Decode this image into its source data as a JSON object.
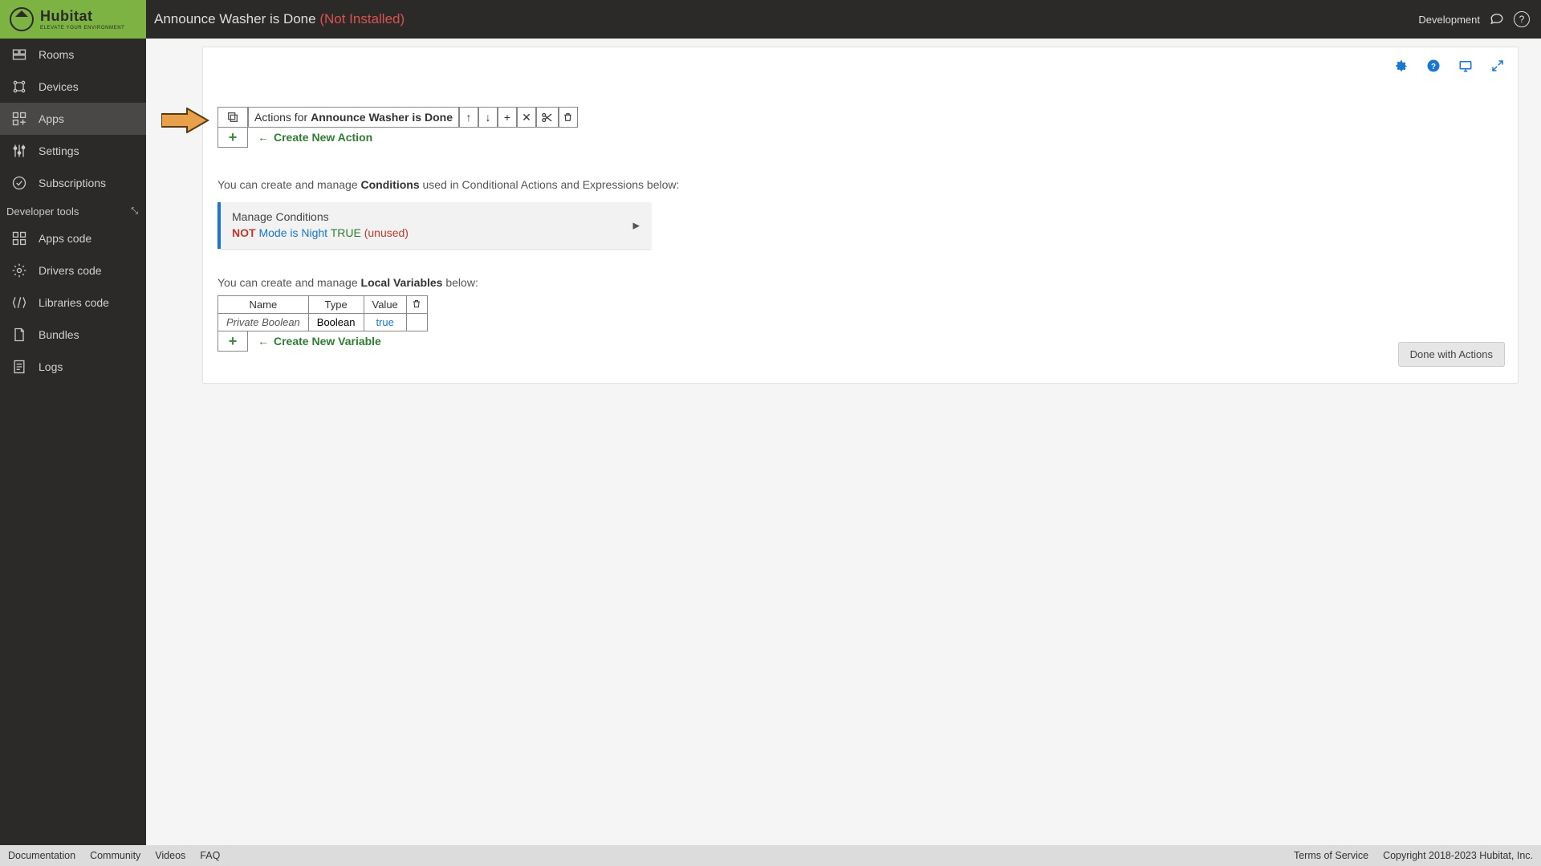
{
  "header": {
    "page_title": "Announce Washer is Done",
    "status_suffix": "(Not Installed)",
    "right_label": "Development",
    "brand": "Hubitat",
    "brand_sub": "ELEVATE YOUR ENVIRONMENT"
  },
  "sidebar": {
    "items": [
      {
        "label": "Rooms"
      },
      {
        "label": "Devices"
      },
      {
        "label": "Apps"
      },
      {
        "label": "Settings"
      },
      {
        "label": "Subscriptions"
      }
    ],
    "dev_header": "Developer tools",
    "dev_items": [
      {
        "label": "Apps code"
      },
      {
        "label": "Drivers code"
      },
      {
        "label": "Libraries code"
      },
      {
        "label": "Bundles"
      },
      {
        "label": "Logs"
      }
    ]
  },
  "actions": {
    "header_prefix": "Actions for",
    "header_name": "Announce Washer is Done",
    "create_label": "Create New Action"
  },
  "conditions": {
    "intro_prefix": "You can create and manage ",
    "intro_bold": "Conditions",
    "intro_suffix": " used in Conditional Actions and Expressions below:",
    "box_title": "Manage Conditions",
    "not": "NOT",
    "mode": "Mode is Night",
    "true": "TRUE",
    "unused": "(unused)"
  },
  "localvars": {
    "intro_prefix": "You can create and manage ",
    "intro_bold": "Local Variables",
    "intro_suffix": " below:",
    "headers": {
      "name": "Name",
      "type": "Type",
      "value": "Value"
    },
    "row": {
      "name": "Private Boolean",
      "type": "Boolean",
      "value": "true"
    },
    "create_label": "Create New Variable"
  },
  "buttons": {
    "done": "Done with Actions"
  },
  "footer": {
    "left": [
      "Documentation",
      "Community",
      "Videos",
      "FAQ"
    ],
    "right": [
      "Terms of Service",
      "Copyright 2018-2023 Hubitat, Inc."
    ]
  }
}
